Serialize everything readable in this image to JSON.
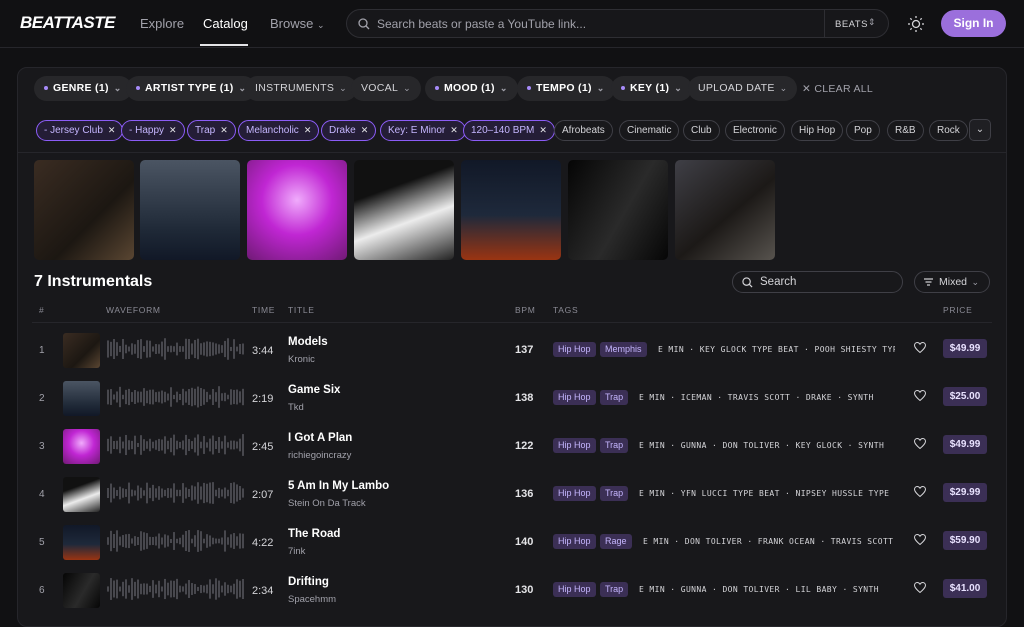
{
  "header": {
    "logo": "BEATTASTE",
    "nav": [
      {
        "label": "Explore"
      },
      {
        "label": "Catalog"
      },
      {
        "label": "Browse"
      }
    ],
    "search_placeholder": "Search beats or paste a YouTube link...",
    "search_mode": "BEATS",
    "sign_in": "Sign In"
  },
  "filters": [
    {
      "label": "GENRE (1)",
      "active": true
    },
    {
      "label": "ARTIST TYPE (1)",
      "active": true
    },
    {
      "label": "INSTRUMENTS",
      "active": false
    },
    {
      "label": "VOCAL",
      "active": false
    },
    {
      "label": "MOOD (1)",
      "active": true
    },
    {
      "label": "TEMPO (1)",
      "active": true
    },
    {
      "label": "KEY (1)",
      "active": true
    },
    {
      "label": "UPLOAD DATE",
      "active": false
    }
  ],
  "clear_all": "CLEAR ALL",
  "selected_tags": [
    "- Jersey Club",
    "- Happy",
    "Trap",
    "Melancholic",
    "Drake",
    "Key: E Minor",
    "120–140 BPM"
  ],
  "suggested_tags": [
    "Afrobeats",
    "Cinematic",
    "Club",
    "Electronic",
    "Hip Hop",
    "Pop",
    "R&B",
    "Rock"
  ],
  "results_title": "7 Instrumentals",
  "table_search_placeholder": "Search",
  "sort_label": "Mixed",
  "columns": {
    "num": "#",
    "waveform": "WAVEFORM",
    "time": "TIME",
    "title": "TITLE",
    "bpm": "BPM",
    "tags": "TAGS",
    "price": "PRICE"
  },
  "rows": [
    {
      "num": "1",
      "title": "Models",
      "artist": "Kronic",
      "time": "3:44",
      "bpm": "137",
      "tag1": "Hip Hop",
      "tag2": "Memphis",
      "keywords": "E MIN · KEY GLOCK TYPE BEAT · POOH SHIESTY TYPE BEAT",
      "price": "$49.99"
    },
    {
      "num": "2",
      "title": "Game Six",
      "artist": "Tkd",
      "time": "2:19",
      "bpm": "138",
      "tag1": "Hip Hop",
      "tag2": "Trap",
      "keywords": "E MIN · ICEMAN · TRAVIS SCOTT · DRAKE · SYNTH",
      "price": "$25.00"
    },
    {
      "num": "3",
      "title": "I Got A Plan",
      "artist": "richiegoincrazy",
      "time": "2:45",
      "bpm": "122",
      "tag1": "Hip Hop",
      "tag2": "Trap",
      "keywords": "E MIN · GUNNA · DON TOLIVER · KEY GLOCK · SYNTH",
      "price": "$49.99"
    },
    {
      "num": "4",
      "title": "5 Am In My Lambo",
      "artist": "Stein On Da Track",
      "time": "2:07",
      "bpm": "136",
      "tag1": "Hip Hop",
      "tag2": "Trap",
      "keywords": "E MIN · YFN LUCCI TYPE BEAT · NIPSEY HUSSLE TYPE BEAT",
      "price": "$29.99"
    },
    {
      "num": "5",
      "title": "The Road",
      "artist": "7ink",
      "time": "4:22",
      "bpm": "140",
      "tag1": "Hip Hop",
      "tag2": "Rage",
      "keywords": "E MIN · DON TOLIVER · FRANK OCEAN · TRAVIS SCOTT · SYNTH",
      "price": "$59.90"
    },
    {
      "num": "6",
      "title": "Drifting",
      "artist": "Spacehmm",
      "time": "2:34",
      "bpm": "130",
      "tag1": "Hip Hop",
      "tag2": "Trap",
      "keywords": "E MIN · GUNNA · DON TOLIVER · LIL BABY · SYNTH",
      "price": "$41.00"
    }
  ],
  "colors": {
    "accent": "#9b6fdc",
    "tag_bg": "#3b2f55",
    "panel": "#18181b"
  }
}
